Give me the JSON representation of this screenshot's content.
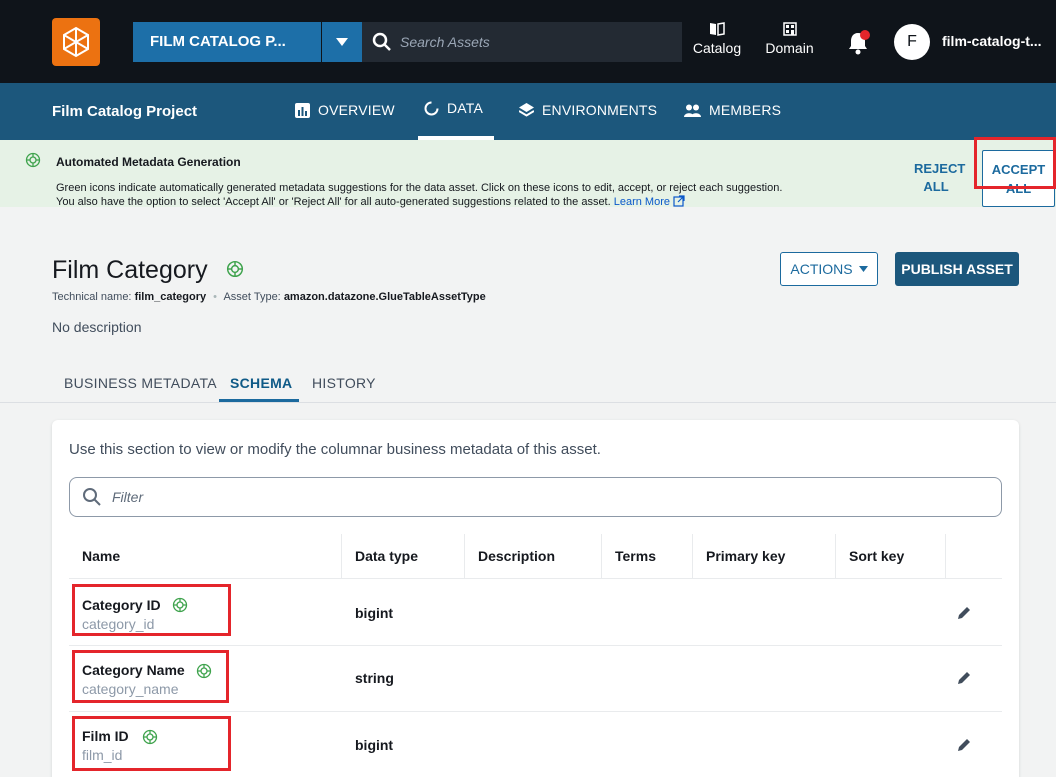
{
  "topbar": {
    "project_selector": "FILM CATALOG P...",
    "search_placeholder": "Search Assets",
    "catalog_label": "Catalog",
    "domain_label": "Domain",
    "avatar_initial": "F",
    "username": "film-catalog-t..."
  },
  "navbar": {
    "project_title": "Film Catalog Project",
    "tabs": [
      {
        "label": "OVERVIEW",
        "icon": "chart-icon"
      },
      {
        "label": "DATA",
        "icon": "circle-icon"
      },
      {
        "label": "ENVIRONMENTS",
        "icon": "layers-icon"
      },
      {
        "label": "MEMBERS",
        "icon": "people-icon"
      }
    ],
    "active_tab": "DATA"
  },
  "banner": {
    "title": "Automated Metadata Generation",
    "line1": "Green icons indicate automatically generated metadata suggestions for the data asset. Click on these icons to edit, accept, or reject each suggestion.",
    "line2": "You also have the option to select 'Accept All' or 'Reject All' for all auto-generated suggestions related to the asset.",
    "learn_more": "Learn More",
    "reject_line1": "REJECT",
    "reject_line2": "ALL",
    "accept_line1": "ACCEPT",
    "accept_line2": "ALL"
  },
  "asset": {
    "title": "Film Category",
    "technical_name_label": "Technical name:",
    "technical_name": "film_category",
    "asset_type_label": "Asset Type:",
    "asset_type": "amazon.datazone.GlueTableAssetType",
    "description": "No description",
    "actions_label": "ACTIONS",
    "publish_label": "PUBLISH ASSET"
  },
  "subtabs": {
    "business": "BUSINESS METADATA",
    "schema": "SCHEMA",
    "history": "HISTORY",
    "active": "SCHEMA"
  },
  "schema": {
    "intro": "Use this section to view or modify the columnar business metadata of this asset.",
    "filter_placeholder": "Filter",
    "columns": [
      "Name",
      "Data type",
      "Description",
      "Terms",
      "Primary key",
      "Sort key"
    ],
    "rows": [
      {
        "name": "Category ID",
        "technical": "category_id",
        "type": "bigint"
      },
      {
        "name": "Category Name",
        "technical": "category_name",
        "type": "string"
      },
      {
        "name": "Film ID",
        "technical": "film_id",
        "type": "bigint"
      }
    ]
  },
  "colors": {
    "topbar": "#0f141a",
    "navbar": "#1c577c",
    "accent": "#1c6a9e",
    "banner_bg": "#e6f2e6",
    "highlight": "#e4252b",
    "ai_icon": "#3fa34d"
  }
}
